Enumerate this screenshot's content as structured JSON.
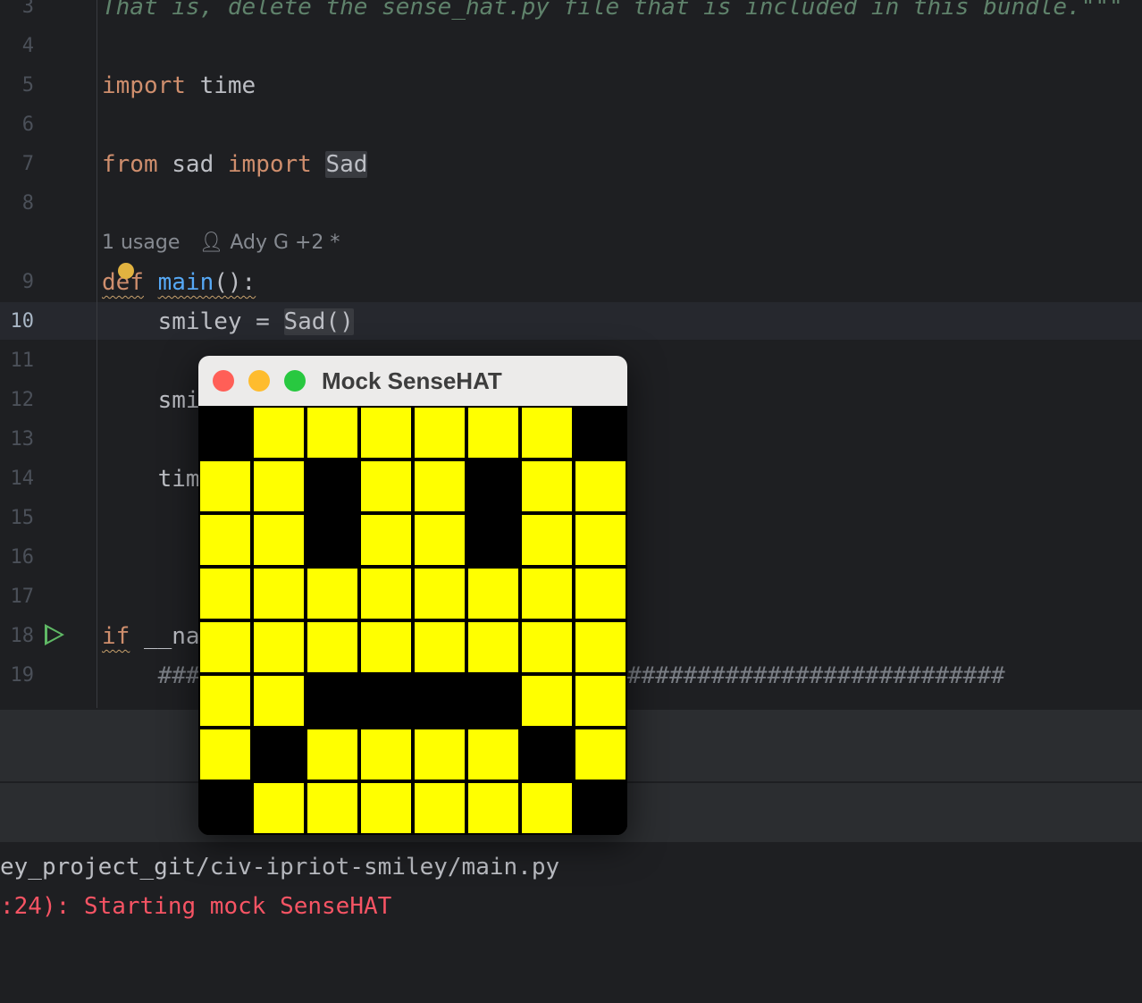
{
  "editor": {
    "line_numbers": [
      "3",
      "4",
      "5",
      "6",
      "7",
      "8",
      "9",
      "10",
      "11",
      "12",
      "13",
      "14",
      "15",
      "16",
      "17",
      "18",
      "19"
    ],
    "line3_text": "That is, delete the sense_hat.py file that is included in this bundle.\"\"\"",
    "line5_kw": "import",
    "line5_rest": " time",
    "line7_kw1": "from",
    "line7_mid": " sad ",
    "line7_kw2": "import",
    "line7_name": "Sad",
    "inlay_usage": "1 usage",
    "inlay_author": "Ady G +2 *",
    "line9_kw": "def",
    "line9_fn": "main",
    "line9_rest": "():",
    "line10_pre": "    smiley = ",
    "line10_call": "Sad()",
    "line12_text": "    smi",
    "line14_text": "    tim",
    "line18_kw": "if",
    "line18_rest": " __na",
    "line19_left": "    ###",
    "line19_right": "###########################"
  },
  "console": {
    "path_line": "ey_project_git/civ-ipriot-smiley/main.py",
    "log_line": ":24): Starting mock SenseHAT"
  },
  "window": {
    "title": "Mock SenseHAT",
    "on_color": "#ffff00",
    "off_color": "#000000",
    "pixels": [
      [
        0,
        1,
        1,
        1,
        1,
        1,
        1,
        0
      ],
      [
        1,
        1,
        0,
        1,
        1,
        0,
        1,
        1
      ],
      [
        1,
        1,
        0,
        1,
        1,
        0,
        1,
        1
      ],
      [
        1,
        1,
        1,
        1,
        1,
        1,
        1,
        1
      ],
      [
        1,
        1,
        1,
        1,
        1,
        1,
        1,
        1
      ],
      [
        1,
        1,
        0,
        0,
        0,
        0,
        1,
        1
      ],
      [
        1,
        0,
        1,
        1,
        1,
        1,
        0,
        1
      ],
      [
        0,
        1,
        1,
        1,
        1,
        1,
        1,
        0
      ]
    ]
  },
  "colors": {
    "keyword": "#cf8e6d",
    "function": "#56a8f5",
    "error_text": "#f75464"
  }
}
